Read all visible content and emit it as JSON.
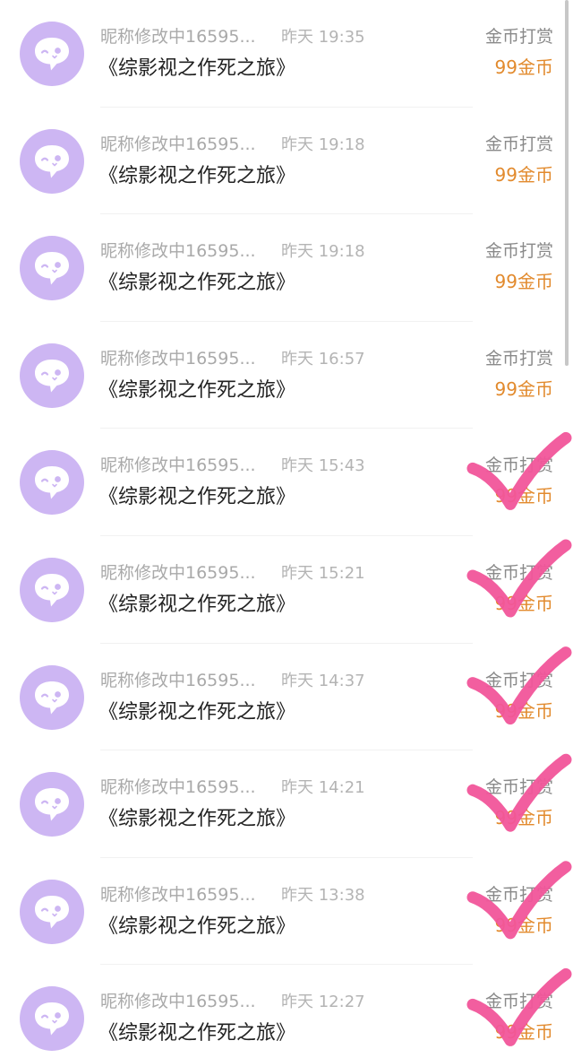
{
  "accent_color": "#e28a2d",
  "avatar_color": "#cdb6f3",
  "check_color": "#f1559a",
  "avatar_icon": "chat-bubble-face-icon",
  "check_icon": "checkmark-icon",
  "items": [
    {
      "nickname": "昵称修改中16595...",
      "time": "昨天 19:35",
      "book": "《综影视之作死之旅》",
      "reward_type": "金币打赏",
      "amount": "99金币",
      "checked": false
    },
    {
      "nickname": "昵称修改中16595...",
      "time": "昨天 19:18",
      "book": "《综影视之作死之旅》",
      "reward_type": "金币打赏",
      "amount": "99金币",
      "checked": false
    },
    {
      "nickname": "昵称修改中16595...",
      "time": "昨天 19:18",
      "book": "《综影视之作死之旅》",
      "reward_type": "金币打赏",
      "amount": "99金币",
      "checked": false
    },
    {
      "nickname": "昵称修改中16595...",
      "time": "昨天 16:57",
      "book": "《综影视之作死之旅》",
      "reward_type": "金币打赏",
      "amount": "99金币",
      "checked": false
    },
    {
      "nickname": "昵称修改中16595...",
      "time": "昨天 15:43",
      "book": "《综影视之作死之旅》",
      "reward_type": "金币打赏",
      "amount": "99金币",
      "checked": true
    },
    {
      "nickname": "昵称修改中16595...",
      "time": "昨天 15:21",
      "book": "《综影视之作死之旅》",
      "reward_type": "金币打赏",
      "amount": "99金币",
      "checked": true
    },
    {
      "nickname": "昵称修改中16595...",
      "time": "昨天 14:37",
      "book": "《综影视之作死之旅》",
      "reward_type": "金币打赏",
      "amount": "99金币",
      "checked": true
    },
    {
      "nickname": "昵称修改中16595...",
      "time": "昨天 14:21",
      "book": "《综影视之作死之旅》",
      "reward_type": "金币打赏",
      "amount": "99金币",
      "checked": true
    },
    {
      "nickname": "昵称修改中16595...",
      "time": "昨天 13:38",
      "book": "《综影视之作死之旅》",
      "reward_type": "金币打赏",
      "amount": "99金币",
      "checked": true
    },
    {
      "nickname": "昵称修改中16595...",
      "time": "昨天 12:27",
      "book": "《综影视之作死之旅》",
      "reward_type": "金币打赏",
      "amount": "99金币",
      "checked": true
    }
  ]
}
